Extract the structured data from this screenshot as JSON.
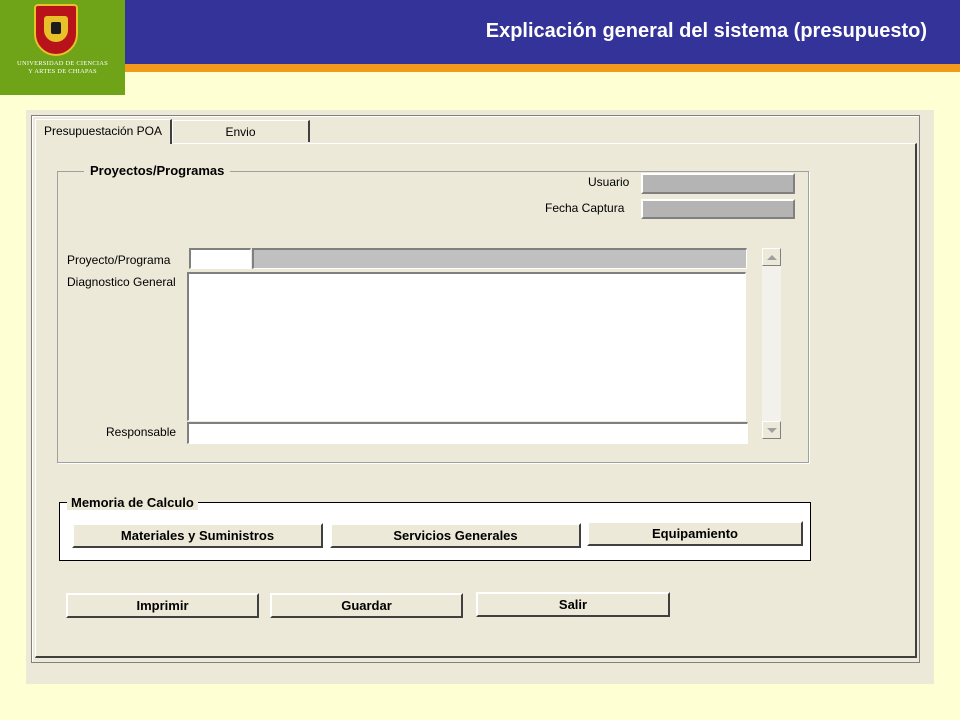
{
  "header": {
    "university_line1": "UNIVERSIDAD DE CIENCIAS",
    "university_line2": "Y ARTES DE CHIAPAS",
    "title": "Explicación general del sistema (presupuesto)"
  },
  "tabs": [
    {
      "label": "Presupuestación POA",
      "active": true
    },
    {
      "label": "Envio",
      "active": false
    }
  ],
  "proyectos": {
    "group_title": "Proyectos/Programas",
    "usuario_label": "Usuario",
    "usuario_value": "",
    "fecha_label": "Fecha Captura",
    "fecha_value": "",
    "proyecto_label": "Proyecto/Programa",
    "proyecto_code": "",
    "proyecto_name": "",
    "diagnostico_label": "Diagnostico General",
    "diagnostico_value": "",
    "responsable_label": "Responsable",
    "responsable_value": ""
  },
  "memoria": {
    "group_title": "Memoria de Calculo",
    "buttons": [
      "Materiales y Suministros",
      "Servicios Generales",
      "Equipamiento"
    ]
  },
  "actions": {
    "imprimir": "Imprimir",
    "guardar": "Guardar",
    "salir": "Salir"
  },
  "colors": {
    "header_blue": "#333399",
    "accent_orange": "#f39a1a",
    "logo_green": "#6fa318",
    "page_bg": "#ffffd4",
    "window_bg": "#ece9d8"
  }
}
